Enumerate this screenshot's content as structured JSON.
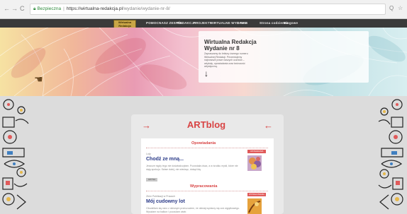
{
  "browser": {
    "back_icon": "←",
    "forward_icon": "→",
    "reload_icon": "C",
    "secure_label": "Bezpieczna",
    "url": "https://wirtualna-redakcja.pl",
    "url_extra": "/wydanie/wydanie-nr-8/",
    "zoom_icon": "Q",
    "star_icon": "☆"
  },
  "site": {
    "logo_text": "Wirtualna Redakcja",
    "nav": [
      {
        "label": "POMOC"
      },
      {
        "label": "NASZ ZESPÓŁ"
      },
      {
        "label": "REDAKCJA"
      },
      {
        "label": "PROJEKTY"
      },
      {
        "label": "WIRTUALNE WYDANIE"
      },
      {
        "label": "O NAS"
      },
      {
        "label": "Strona codzienna"
      },
      {
        "label": "Blogowe"
      }
    ]
  },
  "hero": {
    "title_line1": "Wirtualna Redakcja",
    "title_line2": "Wydanie nr 8",
    "description": "Zapraszamy do lektury ósmego numeru Wirtualnej Redakcji. Prezentujemy najnowsze prace naszych uczniów – artykuły, opowiadania oraz twórczość artystyczną.",
    "arrow": "↓"
  },
  "blog": {
    "title": "ARTblog",
    "arrow_left": "→",
    "arrow_right": "←",
    "sections": [
      {
        "heading": "Opowiadania",
        "posts": [
          {
            "meta": "Luty",
            "title": "Chodź ze mną...",
            "excerpt": "Jeszcze nigdy tego nie doświadczyłam. Pozostała cisza, a w środku myśli, które nie dają spokoju. Szłam dalej, nie wiedząc, dokąd idę.",
            "badge": "OPOWIADANIA",
            "more": "CZYTAJ"
          }
        ]
      },
      {
        "heading": "Wypracowania",
        "posts": [
          {
            "meta": "Zbiór Publikacji w Pracach",
            "title": "Mój cudowny lot",
            "excerpt": "Obudziłam się rano z dziwnym przeczuciem, że dzisiaj wydarzy się coś wyjątkowego. Wyszłam na balkon i poczułam wiatr.",
            "badge": "WYPRACOWANIA",
            "more": "CZYTAJ"
          }
        ]
      }
    ]
  },
  "colors": {
    "accent": "#d84444",
    "post_title": "#2a3a88",
    "nav_bg": "#3a3a3a",
    "page_bg": "#dcdcdc"
  }
}
